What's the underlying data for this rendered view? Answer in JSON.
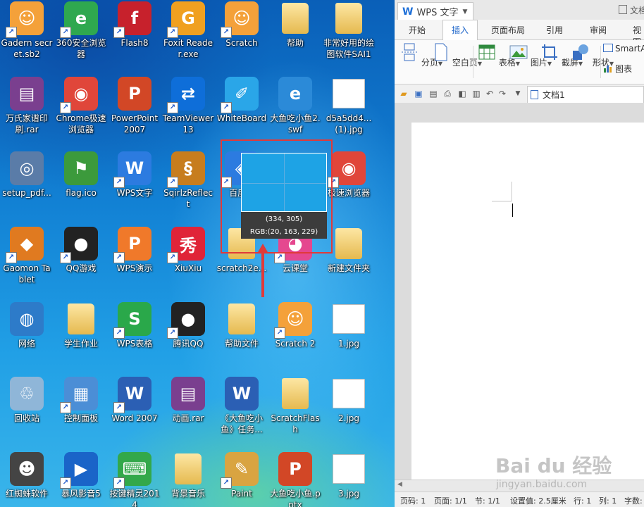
{
  "desktop": {
    "icons": [
      {
        "label": "Gadern secret.sb2",
        "icon": "scratch-cat-icon",
        "color": "#f4a13a"
      },
      {
        "label": "360安全浏览器",
        "icon": "360-browser-icon",
        "color": "#2fa84f"
      },
      {
        "label": "Flash8",
        "icon": "flash-icon",
        "color": "#c7212c"
      },
      {
        "label": "Foxit Reader.exe",
        "icon": "foxit-icon",
        "color": "#f0a020"
      },
      {
        "label": "Scratch",
        "icon": "scratch-cat-icon",
        "color": "#f4a13a"
      },
      {
        "label": "帮助",
        "icon": "folder-icon",
        "color": "#f1cd6b"
      },
      {
        "label": "非常好用的绘图软件SAI1",
        "icon": "folder-icon",
        "color": "#f1cd6b"
      },
      {
        "label": "万氏家谱印刷.rar",
        "icon": "winrar-icon",
        "color": "#7a3f8f"
      },
      {
        "label": "Chrome极速浏览器",
        "icon": "chrome-icon",
        "color": "#e0463a"
      },
      {
        "label": "PowerPoint 2007",
        "icon": "powerpoint-icon",
        "color": "#d24726"
      },
      {
        "label": "TeamViewer 13",
        "icon": "teamviewer-icon",
        "color": "#0e6ed9"
      },
      {
        "label": "WhiteBoard",
        "icon": "whiteboard-icon",
        "color": "#2aa6e8"
      },
      {
        "label": "大鱼吃小鱼2.swf",
        "icon": "ie-icon",
        "color": "#2b8ad8"
      },
      {
        "label": "d5a5dd4...(1).jpg",
        "icon": "image-file-icon",
        "color": "#ffffff"
      },
      {
        "label": "setup_pdf...",
        "icon": "setup-icon",
        "color": "#5a7ca8"
      },
      {
        "label": "flag.ico",
        "icon": "flag-icon",
        "color": "#3c9a3c"
      },
      {
        "label": "WPS文字",
        "icon": "wps-writer-icon",
        "color": "#2c7be0"
      },
      {
        "label": "SqirlzReflect",
        "icon": "sqirlz-icon",
        "color": "#c77d1e"
      },
      {
        "label": "百度...",
        "icon": "baidu-icon",
        "color": "#2c7be0"
      },
      {
        "label": "",
        "icon": "hidden-icon",
        "color": "#ffffff"
      },
      {
        "label": "极速浏览器",
        "icon": "chrome-icon",
        "color": "#e0463a"
      },
      {
        "label": "Gaomon Tablet",
        "icon": "gaomon-icon",
        "color": "#e07a20"
      },
      {
        "label": "QQ游戏",
        "icon": "qq-game-icon",
        "color": "#222222"
      },
      {
        "label": "WPS演示",
        "icon": "wps-presentation-icon",
        "color": "#f0792a"
      },
      {
        "label": "XiuXiu",
        "icon": "xiuxiu-icon",
        "color": "#e02438"
      },
      {
        "label": "scratch2e...",
        "icon": "folder-icon",
        "color": "#f1cd6b"
      },
      {
        "label": "云课堂",
        "icon": "cloud-class-icon",
        "color": "#e5488f"
      },
      {
        "label": "新建文件夹",
        "icon": "folder-icon",
        "color": "#f1cd6b"
      },
      {
        "label": "网络",
        "icon": "network-icon",
        "color": "#2d7bc9"
      },
      {
        "label": "学生作业",
        "icon": "folder-icon",
        "color": "#f1cd6b"
      },
      {
        "label": "WPS表格",
        "icon": "wps-spreadsheet-icon",
        "color": "#2aa84a"
      },
      {
        "label": "腾讯QQ",
        "icon": "qq-icon",
        "color": "#222222"
      },
      {
        "label": "帮助文件",
        "icon": "folder-icon",
        "color": "#f1cd6b"
      },
      {
        "label": "Scratch 2",
        "icon": "scratch-cat-icon",
        "color": "#f4a13a"
      },
      {
        "label": "1.jpg",
        "icon": "image-file-icon",
        "color": "#ffffff"
      },
      {
        "label": "回收站",
        "icon": "recycle-bin-icon",
        "color": "#8fb6d8"
      },
      {
        "label": "控制面板",
        "icon": "control-panel-icon",
        "color": "#4b8ed6"
      },
      {
        "label": "Word 2007",
        "icon": "word-icon",
        "color": "#2b5fb4"
      },
      {
        "label": "动画.rar",
        "icon": "winrar-icon",
        "color": "#7a3f8f"
      },
      {
        "label": "《大鱼吃小鱼》任务...",
        "icon": "word-doc-icon",
        "color": "#2b5fb4"
      },
      {
        "label": "ScratchFlash",
        "icon": "folder-icon",
        "color": "#f1cd6b"
      },
      {
        "label": "2.jpg",
        "icon": "image-file-icon",
        "color": "#ffffff"
      },
      {
        "label": "红蜘蛛软件",
        "icon": "red-spider-icon",
        "color": "#444444"
      },
      {
        "label": "暴风影音5",
        "icon": "storm-player-icon",
        "color": "#1a64c8"
      },
      {
        "label": "按键精灵2014",
        "icon": "key-wizard-icon",
        "color": "#33a84a"
      },
      {
        "label": "背景音乐",
        "icon": "folder-icon",
        "color": "#f1cd6b"
      },
      {
        "label": "Paint",
        "icon": "paint-icon",
        "color": "#d9a441"
      },
      {
        "label": "大鱼吃小鱼.pptx",
        "icon": "pptx-file-icon",
        "color": "#d24726"
      },
      {
        "label": "3.jpg",
        "icon": "image-file-icon",
        "color": "#ffffff"
      }
    ],
    "picker": {
      "coords": "(334, 305)",
      "rgb": "RGB:(20, 163, 229)",
      "sample_color": "#14a3e5"
    }
  },
  "wps": {
    "app_name": "WPS 文字",
    "title_right": "文档",
    "menu": [
      "开始",
      "插入",
      "页面布局",
      "引用",
      "审阅",
      "视图"
    ],
    "active_menu": "插入",
    "ribbon": [
      {
        "label": "分页",
        "icon": "page-break-icon"
      },
      {
        "label": "空白页",
        "icon": "blank-page-icon"
      },
      {
        "label": "表格",
        "icon": "table-icon"
      },
      {
        "label": "图片",
        "icon": "picture-icon"
      },
      {
        "label": "截屏",
        "icon": "screenshot-icon"
      },
      {
        "label": "形状",
        "icon": "shapes-icon"
      }
    ],
    "ribbon_right": [
      {
        "label": "SmartArt",
        "icon": "smartart-icon"
      },
      {
        "label": "图表",
        "icon": "chart-icon"
      }
    ],
    "doc_tab": "文档1",
    "status": {
      "page": "页码: 1",
      "pages": "页面: 1/1",
      "section": "节: 1/1",
      "setting": "设置值: 2.5厘米",
      "row": "行: 1",
      "col": "列: 1",
      "words": "字数:"
    },
    "colors": {
      "accent": "#1d6fd8"
    }
  },
  "watermark": {
    "text": "Bai du 经验",
    "url": "jingyan.baidu.com"
  }
}
